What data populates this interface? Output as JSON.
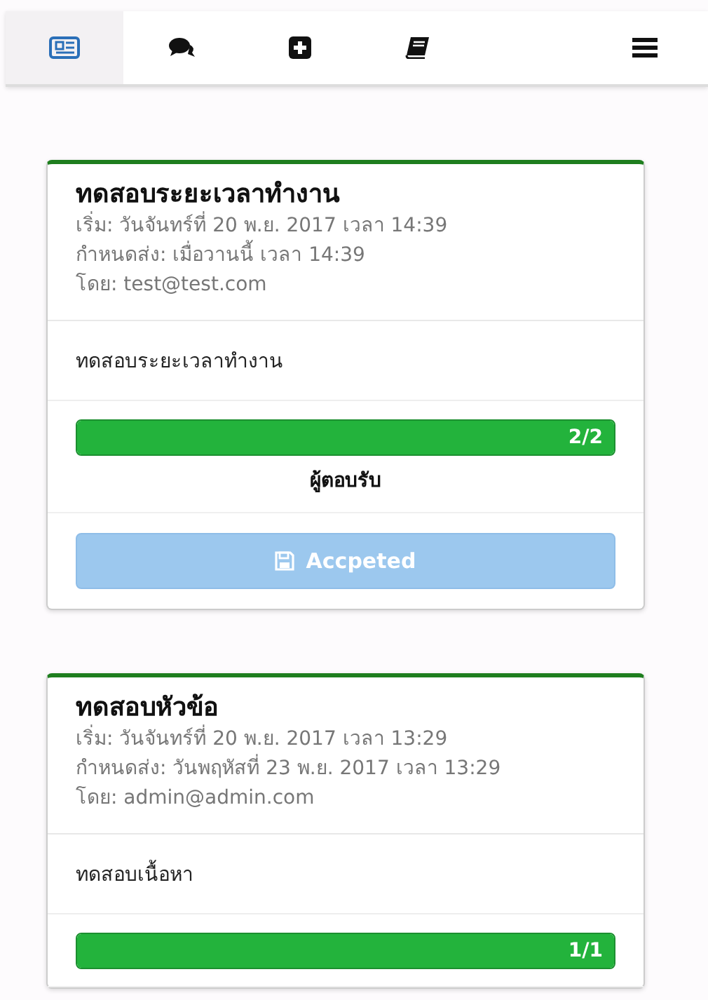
{
  "nav": {
    "tabs": [
      {
        "kind": "news",
        "selected": true
      },
      {
        "kind": "comments",
        "selected": false
      },
      {
        "kind": "plus",
        "selected": false
      },
      {
        "kind": "book",
        "selected": false
      }
    ],
    "menu": {
      "kind": "hamburger"
    }
  },
  "cards": [
    {
      "title": "ทดสอบระยะเวลาทำงาน",
      "start": "เริ่ม: วันจันทร์ที่ 20 พ.ย. 2017 เวลา 14:39",
      "due": "กำหนดส่ง: เมื่อวานนี้ เวลา 14:39",
      "by": "โดย: test@test.com",
      "body": "ทดสอบระยะเวลาทำงาน",
      "progress": {
        "level": 1,
        "label": "2/2"
      },
      "caption": "ผู้ตอบรับ",
      "button": {
        "label": "Accpeted",
        "disabled": true
      }
    },
    {
      "title": "ทดสอบหัวข้อ",
      "start": "เริ่ม: วันจันทร์ที่ 20 พ.ย. 2017 เวลา 13:29",
      "due": "กำหนดส่ง: วันพฤหัสที่ 23 พ.ย. 2017 เวลา 13:29",
      "by": "โดย: admin@admin.com",
      "body": "ทดสอบเนื้อหา",
      "progress": {
        "level": 1,
        "label": "1/1"
      }
    }
  ]
}
